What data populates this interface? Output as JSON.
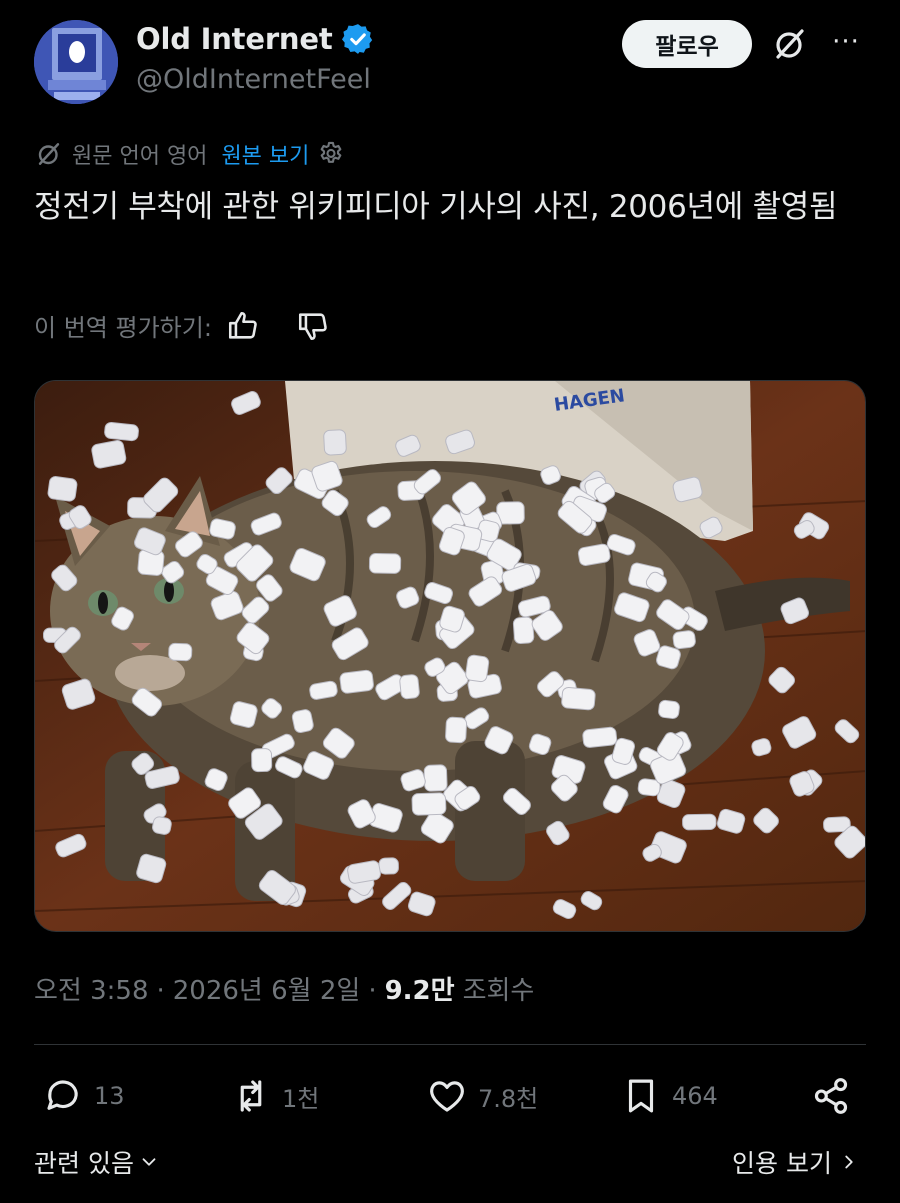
{
  "author": {
    "display_name": "Old Internet",
    "handle": "@OldInternetFeel",
    "verified": true,
    "avatar_icon": "retro-computer-avatar"
  },
  "header": {
    "follow_label": "팔로우",
    "grok_icon": "grok-icon",
    "more_label": "···"
  },
  "translation": {
    "note": "원문 언어 영어",
    "show_original_label": "원본 보기",
    "gear_icon": "gear-icon"
  },
  "tweet": {
    "text": "정전기 부착에 관한 위키피디아 기사의 사진, 2006년에 촬영됨"
  },
  "rate": {
    "label": "이 번역 평가하기:",
    "like_icon": "thumbs-up-icon",
    "dislike_icon": "thumbs-down-icon"
  },
  "meta": {
    "time": "오전 3:58",
    "sep1": "·",
    "date": "2026년 6월 2일",
    "sep2": "·",
    "views_count": "9.2만",
    "views_label": "조회수"
  },
  "actions": {
    "replies": "13",
    "reposts": "1천",
    "likes": "7.8천",
    "bookmarks": "464"
  },
  "footer": {
    "related_label": "관련 있음",
    "quotes_label": "인용 보기"
  },
  "colors": {
    "background": "#000000",
    "text_primary": "#e7e9ea",
    "text_secondary": "#71767b",
    "link": "#1d9bf0",
    "verified": "#1d9bf0",
    "divider": "#2f3336"
  }
}
